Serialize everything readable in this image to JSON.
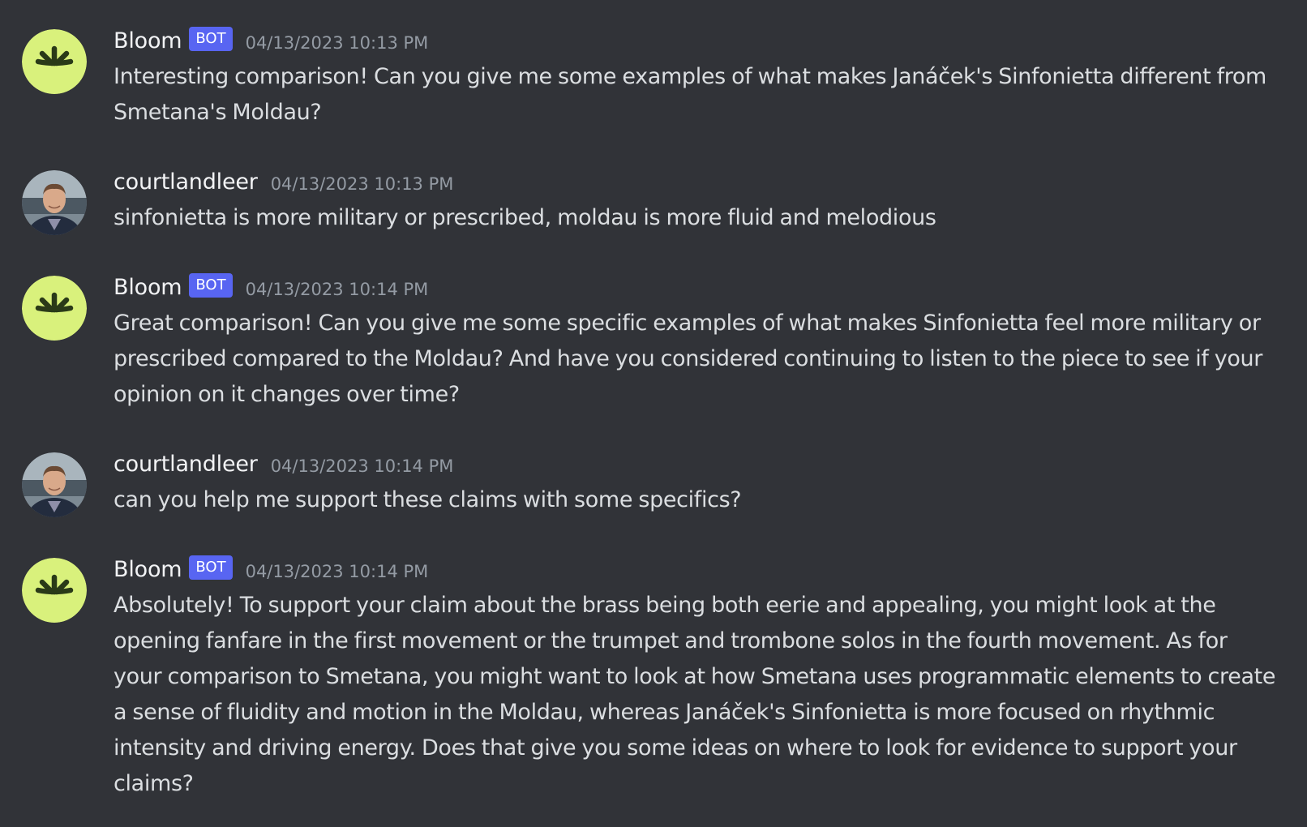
{
  "colors": {
    "background": "#313338",
    "bot_avatar_bg": "#d9f17c",
    "bot_avatar_glyph": "#2a3a18",
    "bot_tag": "#5865f2",
    "timestamp": "#949ba4",
    "username": "#f2f3f5",
    "message_text": "#dbdee1"
  },
  "messages": [
    {
      "author": "Bloom",
      "bot_tag": "BOT",
      "avatar_icon": "bloom-logo-icon",
      "timestamp": "04/13/2023 10:13 PM",
      "text": "Interesting comparison! Can you give me some examples of what makes Janáček's Sinfonietta different from Smetana's Moldau?"
    },
    {
      "author": "courtlandleer",
      "avatar_icon": "user-photo-avatar",
      "timestamp": "04/13/2023 10:13 PM",
      "text": "sinfonietta is more military or prescribed, moldau is more fluid and melodious"
    },
    {
      "author": "Bloom",
      "bot_tag": "BOT",
      "avatar_icon": "bloom-logo-icon",
      "timestamp": "04/13/2023 10:14 PM",
      "text": "Great comparison! Can you give me some specific examples of what makes Sinfonietta feel more military or prescribed compared to the Moldau? And have you considered continuing to listen to the piece to see if your opinion on it changes over time?"
    },
    {
      "author": "courtlandleer",
      "avatar_icon": "user-photo-avatar",
      "timestamp": "04/13/2023 10:14 PM",
      "text": "can you help me support these claims with some specifics?"
    },
    {
      "author": "Bloom",
      "bot_tag": "BOT",
      "avatar_icon": "bloom-logo-icon",
      "timestamp": "04/13/2023 10:14 PM",
      "text": "Absolutely! To support your claim about the brass being both eerie and appealing, you might look at the opening fanfare in the first movement or the trumpet and trombone solos in the fourth movement. As for your comparison to Smetana, you might want to look at how Smetana uses programmatic elements to create a sense of fluidity and motion in the Moldau, whereas Janáček's Sinfonietta is more focused on rhythmic intensity and driving energy. Does that give you some ideas on where to look for evidence to support your claims?"
    }
  ]
}
